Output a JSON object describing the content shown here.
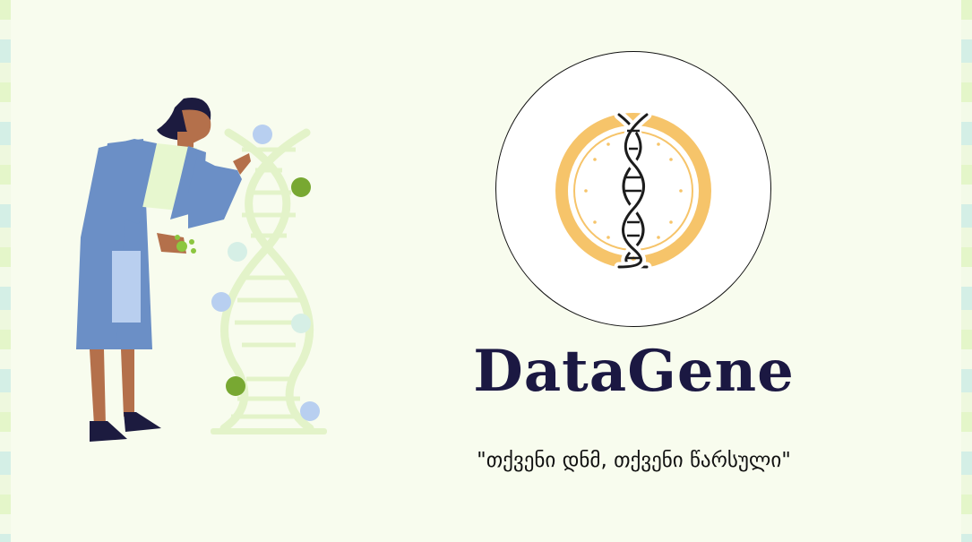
{
  "brand": {
    "name": "DataGene",
    "slogan": "\"თქვენი დნმ, თქვენი წარსული\""
  },
  "colors": {
    "background": "#f8fcee",
    "title": "#1b1842",
    "logo_ring": "#f6c46a",
    "coat": "#6b8fc6",
    "helix": "#e3f3c9"
  },
  "icons": {
    "logo": "dna-helix-icon",
    "illustration": "scientist-with-dna-illustration"
  }
}
